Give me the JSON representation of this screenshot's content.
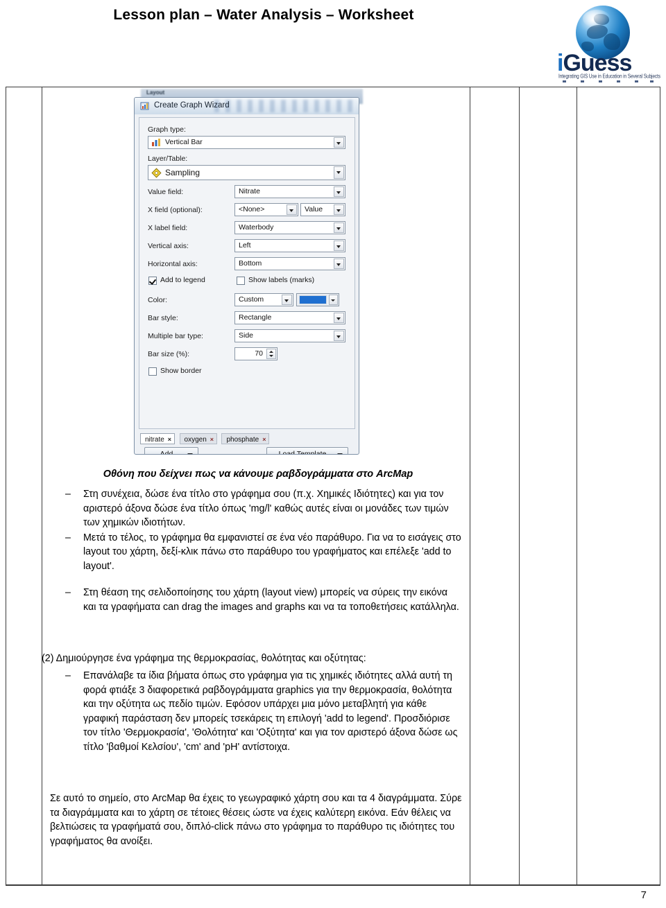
{
  "header": {
    "title": "Lesson plan – Water Analysis – Worksheet",
    "logo": {
      "word_i": "i",
      "word_rest": "Guess",
      "tagline": "Integrating GIS Use in Education in Several Subjects"
    }
  },
  "screenshot": {
    "background_window_label": "Layout",
    "dialog": {
      "title": "Create Graph Wizard",
      "icon": "graph-wizard-icon",
      "fields": [
        {
          "label": "Graph type:",
          "value": "Vertical Bar",
          "icon": "bar-chart-icon"
        },
        {
          "label": "Layer/Table:",
          "value": "Sampling",
          "icon": "layer-diamond-icon"
        },
        {
          "label": "Value field:",
          "value": "Nitrate"
        },
        {
          "label": "X field (optional):",
          "value": "<None>",
          "value2": "Value"
        },
        {
          "label": "X label field:",
          "value": "Waterbody"
        },
        {
          "label": "Vertical axis:",
          "value": "Left"
        },
        {
          "label": "Horizontal axis:",
          "value": "Bottom"
        },
        {
          "label": "Color:",
          "value": "Custom"
        },
        {
          "label": "Bar style:",
          "value": "Rectangle"
        },
        {
          "label": "Multiple bar type:",
          "value": "Side"
        },
        {
          "label": "Bar size (%):",
          "value": "70"
        }
      ],
      "checkboxes": [
        {
          "label": "Add to legend",
          "checked": true
        },
        {
          "label": "Show labels (marks)",
          "checked": false
        },
        {
          "label": "Show border",
          "checked": false
        }
      ],
      "color_swatch_hex": "#1f6fd0",
      "tabs": [
        {
          "label": "nitrate",
          "close": "×",
          "active": true
        },
        {
          "label": "oxygen",
          "close": "×",
          "active": false
        },
        {
          "label": "phosphate",
          "close": "×",
          "active": false
        }
      ],
      "buttons": {
        "add": "Add",
        "load_template": "Load Template"
      }
    }
  },
  "body": {
    "caption": "Οθόνη που δείχνει πως να κάνουμε ραβδογράμματα στο ArcMap",
    "bullets_1": [
      "Στη συνέχεια, δώσε ένα τίτλο στο γράφημα σου (π.χ. Χημικές Ιδιότητες) και για τον αριστερό άξονα δώσε ένα τίτλο όπως 'mg/l' καθώς αυτές είναι οι μονάδες των τιμών των χημικών ιδιοτήτων.",
      "Μετά το τέλος, το γράφημα θα εμφανιστεί σε ένα νέο παράθυρο. Για να το εισάγεις στο layout του χάρτη, δεξί-κλικ πάνω στο παράθυρο του γραφήματος και επέλεξε 'add to layout'.",
      "Στη θέαση της σελιδοποίησης του χάρτη (layout view) μπορείς να σύρεις την εικόνα και τα γραφήματα can drag the images and graphs και να τα τοποθετήσεις κατάλληλα."
    ],
    "section_2_heading": "(2) Δημιούργησε ένα γράφημα της θερμοκρασίας, θολότητας και οξύτητας:",
    "bullets_2": [
      "Επανάλαβε τα ίδια βήματα όπως στο γράφημα για τις χημικές ιδιότητες αλλά αυτή τη φορά φτιάξε 3 διαφορετικά ραβδογράμματα graphics για την θερμοκρασία, θολότητα και την οξύτητα ως πεδίο τιμών. Εφόσον υπάρχει μια μόνο μεταβλητή για κάθε γραφική παράσταση δεν μπορείς τσεκάρεις τη επιλογή 'add to legend'. Προσδιόρισε τον τίτλο  'Θερμοκρασία', 'Θολότητα' και 'Οξύτητα' και για τον αριστερό άξονα δώσε ως τίτλο 'βαθμοί Κελσίου', 'cm' and 'pH' αντίστοιχα."
    ],
    "closing_paragraph": "Σε αυτό το σημείο, στο ArcMap θα έχεις το γεωγραφικό χάρτη σου και τα  4 διαγράμματα. Σύρε τα διαγράμματα και το χάρτη σε τέτοιες θέσεις ώστε να έχεις καλύτερη εικόνα. Εάν θέλεις να βελτιώσεις τα γραφήματά σου, διπλό-click πάνω στο γράφημα το παράθυρο τις ιδιότητες του γραφήματος θα ανοίξει."
  },
  "footer": {
    "page_number": "7"
  }
}
